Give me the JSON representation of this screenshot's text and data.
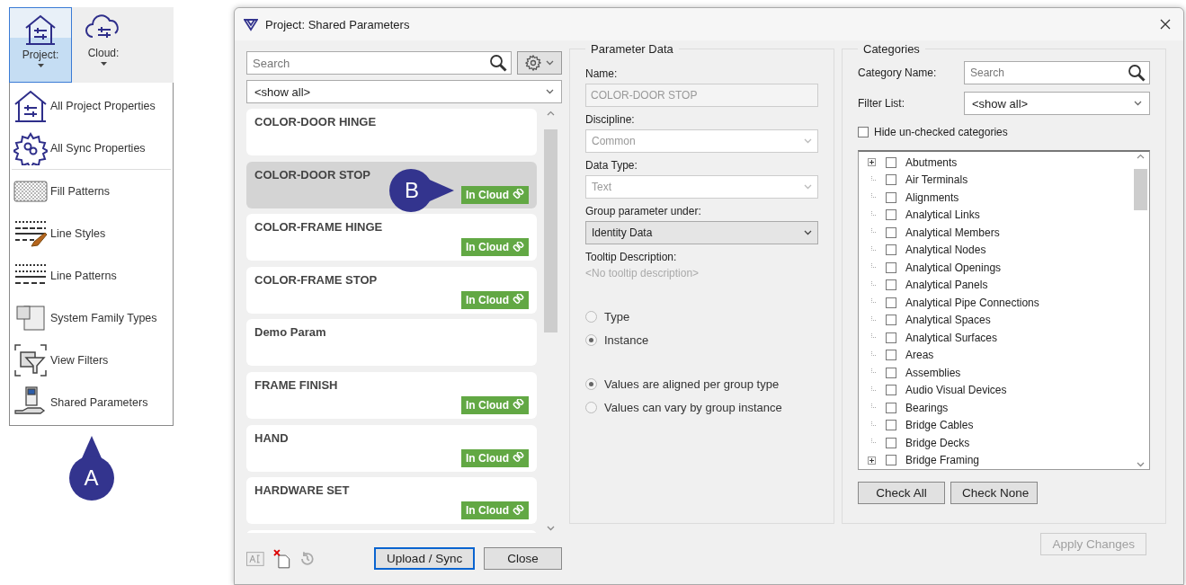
{
  "ribbon": {
    "buttons": [
      {
        "label": "Project:",
        "kind": "project",
        "selected": true
      },
      {
        "label": "Cloud:",
        "kind": "cloud",
        "selected": false
      }
    ]
  },
  "menu": {
    "groups": [
      [
        {
          "label": "All Project Properties",
          "kind": "house"
        },
        {
          "label": "All Sync Properties",
          "kind": "gear"
        }
      ],
      [
        {
          "label": "Fill Patterns",
          "kind": "hatch"
        },
        {
          "label": "Line Styles",
          "kind": "brush"
        },
        {
          "label": "Line Patterns",
          "kind": "dashes"
        },
        {
          "label": "System Family Types",
          "kind": "shapes"
        },
        {
          "label": "View Filters",
          "kind": "filter"
        },
        {
          "label": "Shared Parameters",
          "kind": "hand"
        }
      ]
    ]
  },
  "callout_menu": "A",
  "callout_list": "B",
  "dialog": {
    "title": "Project: Shared Parameters",
    "search": {
      "placeholder": "Search"
    },
    "filter": "<show all>",
    "parameters": [
      {
        "name": "COLOR-DOOR HINGE",
        "in_cloud": false,
        "selected": false
      },
      {
        "name": "COLOR-DOOR STOP",
        "in_cloud": true,
        "badge": "In Cloud",
        "selected": true
      },
      {
        "name": "COLOR-FRAME HINGE",
        "in_cloud": true,
        "badge": "In Cloud",
        "selected": false
      },
      {
        "name": "COLOR-FRAME STOP",
        "in_cloud": true,
        "badge": "In Cloud",
        "selected": false
      },
      {
        "name": "Demo Param",
        "in_cloud": false,
        "selected": false
      },
      {
        "name": "FRAME FINISH",
        "in_cloud": true,
        "badge": "In Cloud",
        "selected": false
      },
      {
        "name": "HAND",
        "in_cloud": true,
        "badge": "In Cloud",
        "selected": false
      },
      {
        "name": "HARDWARE SET",
        "in_cloud": true,
        "badge": "In Cloud",
        "selected": false
      }
    ],
    "footer_buttons": [
      {
        "label": "Upload / Sync",
        "kind": "primary"
      },
      {
        "label": "Close",
        "kind": "normal"
      }
    ],
    "parameter_data": {
      "title": "Parameter Data",
      "fields": [
        {
          "label": "Name:",
          "value": "COLOR-DOOR STOP",
          "kind": "text",
          "disabled": true
        },
        {
          "label": "Discipline:",
          "value": "Common",
          "kind": "dropdown",
          "disabled": true
        },
        {
          "label": "Data Type:",
          "value": "Text",
          "kind": "dropdown",
          "disabled": true
        },
        {
          "label": "Group parameter under:",
          "value": "Identity Data",
          "kind": "dropdown",
          "disabled": false
        }
      ],
      "tooltip_label": "Tooltip Description:",
      "tooltip_placeholder": "<No tooltip description>",
      "scope": [
        {
          "label": "Type",
          "selected": false
        },
        {
          "label": "Instance",
          "selected": true
        }
      ],
      "group_values": [
        {
          "label": "Values are aligned per group type",
          "selected": true
        },
        {
          "label": "Values can vary by group instance",
          "selected": false
        }
      ]
    },
    "categories": {
      "title": "Categories",
      "name_label": "Category Name:",
      "search_placeholder": "Search",
      "filter_label": "Filter List:",
      "filter": "<show all>",
      "hide_unchecked": {
        "label": "Hide un-checked categories",
        "checked": false
      },
      "items": [
        {
          "label": "Abutments",
          "checked": false,
          "expandable": true
        },
        {
          "label": "Air Terminals",
          "checked": false,
          "expandable": false
        },
        {
          "label": "Alignments",
          "checked": false,
          "expandable": false
        },
        {
          "label": "Analytical Links",
          "checked": false,
          "expandable": false
        },
        {
          "label": "Analytical Members",
          "checked": false,
          "expandable": false
        },
        {
          "label": "Analytical Nodes",
          "checked": false,
          "expandable": false
        },
        {
          "label": "Analytical Openings",
          "checked": false,
          "expandable": false
        },
        {
          "label": "Analytical Panels",
          "checked": false,
          "expandable": false
        },
        {
          "label": "Analytical Pipe Connections",
          "checked": false,
          "expandable": false
        },
        {
          "label": "Analytical Spaces",
          "checked": false,
          "expandable": false
        },
        {
          "label": "Analytical Surfaces",
          "checked": false,
          "expandable": false
        },
        {
          "label": "Areas",
          "checked": false,
          "expandable": false
        },
        {
          "label": "Assemblies",
          "checked": false,
          "expandable": false
        },
        {
          "label": "Audio Visual Devices",
          "checked": false,
          "expandable": false
        },
        {
          "label": "Bearings",
          "checked": false,
          "expandable": false
        },
        {
          "label": "Bridge Cables",
          "checked": false,
          "expandable": false
        },
        {
          "label": "Bridge Decks",
          "checked": false,
          "expandable": false
        },
        {
          "label": "Bridge Framing",
          "checked": false,
          "expandable": true
        }
      ],
      "buttons": [
        "Check All",
        "Check None"
      ]
    },
    "apply": {
      "label": "Apply Changes",
      "disabled": true
    }
  }
}
